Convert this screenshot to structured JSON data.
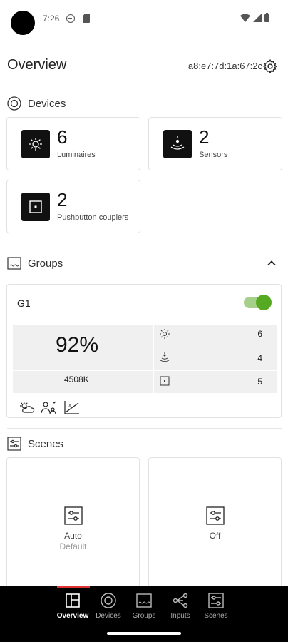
{
  "status_bar": {
    "time": "7:26"
  },
  "header": {
    "title": "Overview",
    "device_id": "a8:e7:7d:1a:67:2c"
  },
  "devices": {
    "title": "Devices",
    "items": [
      {
        "count": "6",
        "label": "Luminaires",
        "icon": "sun-icon"
      },
      {
        "count": "2",
        "label": "Sensors",
        "icon": "sensor-icon"
      },
      {
        "count": "2",
        "label": "Pushbutton couplers",
        "icon": "pushbutton-icon"
      }
    ]
  },
  "groups": {
    "title": "Groups",
    "items": [
      {
        "name": "G1",
        "enabled": true,
        "level": "92%",
        "cct": "4508K",
        "luminaires": "6",
        "sensors": "4",
        "pushbuttons": "5"
      }
    ]
  },
  "scenes": {
    "title": "Scenes",
    "items": [
      {
        "name": "Auto",
        "subtitle": "Default"
      },
      {
        "name": "Off"
      }
    ]
  },
  "nav": {
    "items": [
      {
        "label": "Overview",
        "active": true
      },
      {
        "label": "Devices",
        "active": false
      },
      {
        "label": "Groups",
        "active": false
      },
      {
        "label": "Inputs",
        "active": false
      },
      {
        "label": "Scenes",
        "active": false
      }
    ]
  },
  "colors": {
    "toggle_on": "#55aa22",
    "accent": "#d33333",
    "nav_bg": "#000000"
  }
}
